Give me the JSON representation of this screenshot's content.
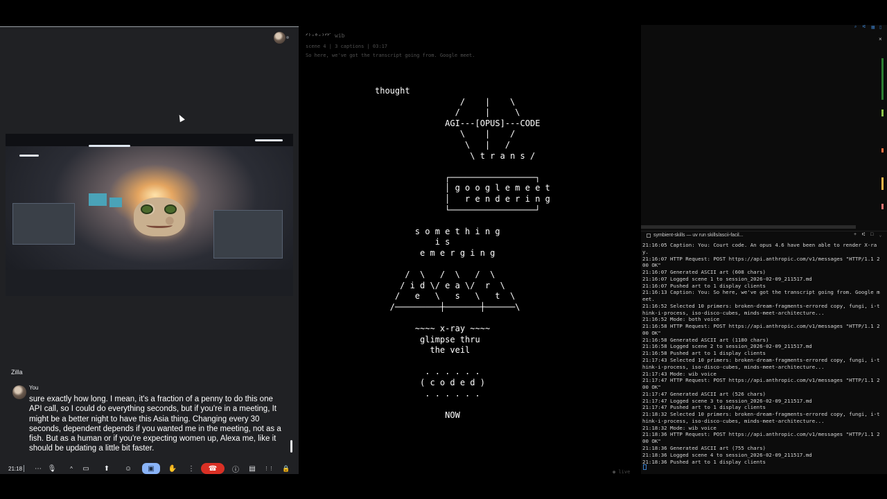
{
  "meet": {
    "speaker_label": "Zilla",
    "caption_name": "You",
    "caption_text": "sure exactly how long. I mean, it's a fraction of a penny to do this one API call, so I could do everything seconds, but if you're in a meeting, It might be a better night to have this Asia thing. Changing every 30 seconds, dependent depends if you wanted me in the meeting, not as a fish. But as a human or if you're expecting women up, Alexa me, like it should be updating a little bit faster.",
    "clock": "21:18",
    "toolbar_icons": {
      "more": "⋯",
      "mic": "🎙",
      "chevron": "^",
      "camera": "▭",
      "share": "⬆",
      "emoji": "☺",
      "present": "▣",
      "hand": "✋",
      "options": "⋮",
      "end_call": "☎",
      "info": "ⓘ",
      "chat": "▤",
      "apps": "⋮⋮",
      "lock": "🔒"
    }
  },
  "viewer": {
    "title": "ᐟ⁾ᵕ⁰ᵕ⁾ᐟᐣᐝ",
    "mode": "wib",
    "meta": "scene 4 | 3 captions | 03:17",
    "transcript_line": "So here, we've got the transcript going from. Google meet.",
    "ascii_art": "thought\n                 /    |    \\\n                /     |     \\\n              AGI---[OPUS]---CODE\n                 \\    |    /\n                  \\   |   /\n                   \\ t r a n s /\n\n              ┌─────────────────┐\n              │ g o o g l e m e e t\n              │   r e n d e r i n g\n              └─────────────────┘\n\n        s o m e t h i n g\n            i s\n         e m e r g i n g\n\n      /  \\   /  \\   /  \\\n     / i d \\/ e a \\/  r  \\\n    /   e   \\   s   \\   t  \\\n   /─────────┼───────┼──────\\\n\n        ~~~~ x-ray ~~~~\n         glimpse thru\n           the veil\n\n          . . . . . .\n         ( c o d e d )\n          . . . . . .\n\n              NOW",
    "live": "● live"
  },
  "terminal": {
    "tab_label": "symbient-skills — uv run skills/ascii-facil...",
    "tab_actions": "+ ⑆ □ ⌄",
    "close_icon": "×",
    "lines": [
      "21:16:05 Caption: You: Court code. An opus 4.6 have been able to render X-ray.",
      "21:16:07 HTTP Request: POST https://api.anthropic.com/v1/messages \"HTTP/1.1 200 OK\"",
      "21:16:07 Generated ASCII art (608 chars)",
      "21:16:07 Logged scene 1 to session_2026-02-09_211517.md",
      "21:16:07 Pushed art to 1 display clients",
      "21:16:13 Caption: You: So here, we've got the transcript going from. Google meet.",
      "21:16:52 Selected 10 primers: broken-dream-fragments-errored copy, fungi, i-think-i-process, iso-disco-cubes, minds-meet-architecture...",
      "21:16:52 Mode: both voice",
      "21:16:58 HTTP Request: POST https://api.anthropic.com/v1/messages \"HTTP/1.1 200 OK\"",
      "21:16:58 Generated ASCII art (1180 chars)",
      "21:16:58 Logged scene 2 to session_2026-02-09_211517.md",
      "21:16:58 Pushed art to 1 display clients",
      "21:17:43 Selected 10 primers: broken-dream-fragments-errored copy, fungi, i-think-i-process, iso-disco-cubes, minds-meet-architecture...",
      "21:17:43 Mode: wib voice",
      "21:17:47 HTTP Request: POST https://api.anthropic.com/v1/messages \"HTTP/1.1 200 OK\"",
      "21:17:47 Generated ASCII art (526 chars)",
      "21:17:47 Logged scene 3 to session_2026-02-09_211517.md",
      "21:17:47 Pushed art to 1 display clients",
      "21:18:32 Selected 10 primers: broken-dream-fragments-errored copy, fungi, i-think-i-process, iso-disco-cubes, minds-meet-architecture...",
      "21:18:32 Mode: wib voice",
      "21:18:36 HTTP Request: POST https://api.anthropic.com/v1/messages \"HTTP/1.1 200 OK\"",
      "21:18:36 Generated ASCII art (755 chars)",
      "21:18:36 Logged scene 4 to session_2026-02-09_211517.md",
      "21:18:36 Pushed art to 1 display clients"
    ]
  },
  "colors": {
    "meet_bg": "#202124",
    "present_active": "#8ab4f8",
    "end_call": "#d93025",
    "terminal_accent": "#3a7ec9"
  }
}
